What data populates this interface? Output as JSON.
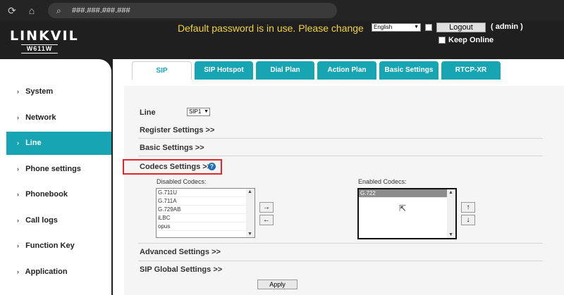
{
  "browser": {
    "url": "###.###.###.###"
  },
  "header": {
    "logo_main": "LINKVIL",
    "logo_sub": "W611W",
    "warning": "Default password is in use. Please change",
    "language": "English",
    "logout_label": "Logout",
    "user": "( admin )",
    "keep_online_label": "Keep Online"
  },
  "sidebar": {
    "items": [
      {
        "label": "System"
      },
      {
        "label": "Network"
      },
      {
        "label": "Line"
      },
      {
        "label": "Phone settings"
      },
      {
        "label": "Phonebook"
      },
      {
        "label": "Call logs"
      },
      {
        "label": "Function Key"
      },
      {
        "label": "Application"
      }
    ],
    "active": "Line"
  },
  "tabs": [
    {
      "label": "SIP"
    },
    {
      "label": "SIP Hotspot"
    },
    {
      "label": "Dial Plan"
    },
    {
      "label": "Action Plan"
    },
    {
      "label": "Basic Settings"
    },
    {
      "label": "RTCP-XR"
    }
  ],
  "main": {
    "line_label": "Line",
    "line_value": "SIP1",
    "register_settings": "Register Settings >>",
    "basic_settings": "Basic Settings >>",
    "codecs_settings": "Codecs Settings >>",
    "disabled_caption": "Disabled Codecs:",
    "enabled_caption": "Enabled Codecs:",
    "disabled_codecs": [
      "G.711U",
      "G.711A",
      "G.729AB",
      "iLBC",
      "opus"
    ],
    "enabled_codecs": [
      "G.722"
    ],
    "move_right": "→",
    "move_left": "←",
    "move_up": "↑",
    "move_down": "↓",
    "advanced_settings": "Advanced Settings >>",
    "sip_global_settings": "SIP Global Settings >>",
    "apply_label": "Apply"
  },
  "colors": {
    "accent": "#17a5b3",
    "warning": "#f2d33a",
    "header_bg": "#1f1f1f",
    "highlight": "#e1262c"
  }
}
